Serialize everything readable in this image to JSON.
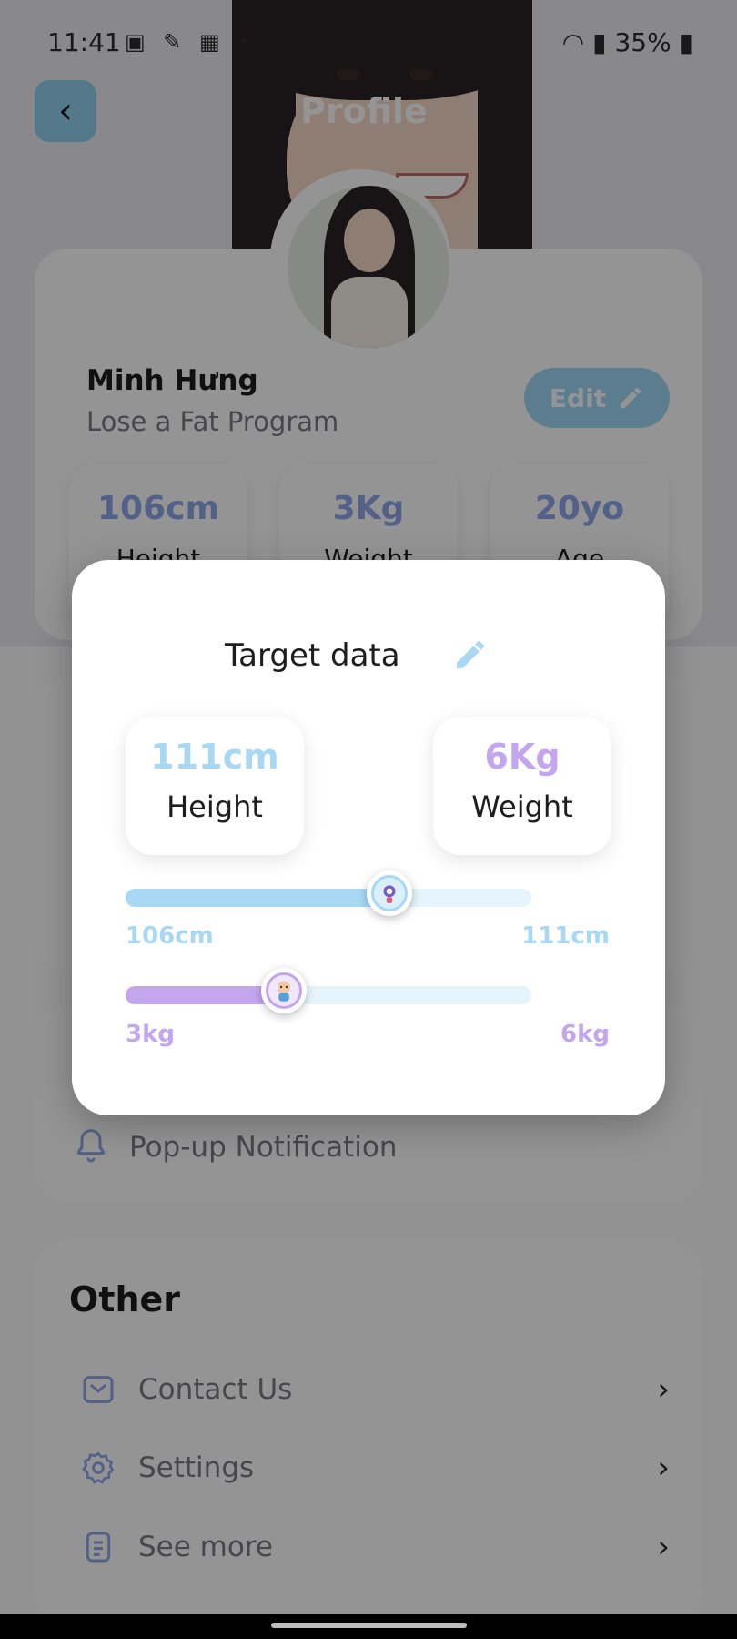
{
  "status_bar": {
    "time": "11:41",
    "battery": "35%"
  },
  "header": {
    "title": "Profile",
    "back_icon": "chevron-left-icon"
  },
  "profile": {
    "name": "Minh Hưng",
    "program": "Lose a Fat Program",
    "edit_label": "Edit",
    "stats": [
      {
        "value": "106cm",
        "label": "Height"
      },
      {
        "value": "3Kg",
        "label": "Weight"
      },
      {
        "value": "20yo",
        "label": "Age"
      }
    ]
  },
  "notification": {
    "label": "Pop-up Notification",
    "icon": "bell-icon"
  },
  "other": {
    "title": "Other",
    "items": [
      {
        "label": "Contact Us",
        "icon": "mail-icon"
      },
      {
        "label": "Settings",
        "icon": "gear-icon"
      },
      {
        "label": "See more",
        "icon": "document-icon"
      }
    ]
  },
  "modal": {
    "title": "Target data",
    "height": {
      "value": "111cm",
      "label": "Height",
      "min_label": "106cm",
      "max_label": "111cm",
      "fill_fraction": 0.65
    },
    "weight": {
      "value": "6Kg",
      "label": "Weight",
      "min_label": "3kg",
      "max_label": "6kg",
      "fill_fraction": 0.39
    }
  },
  "colors": {
    "height_accent": "#a8d8f3",
    "weight_accent": "#c4a6ef",
    "stat_value": "#8fa6e8",
    "edit_button": "#9ed8f4"
  }
}
